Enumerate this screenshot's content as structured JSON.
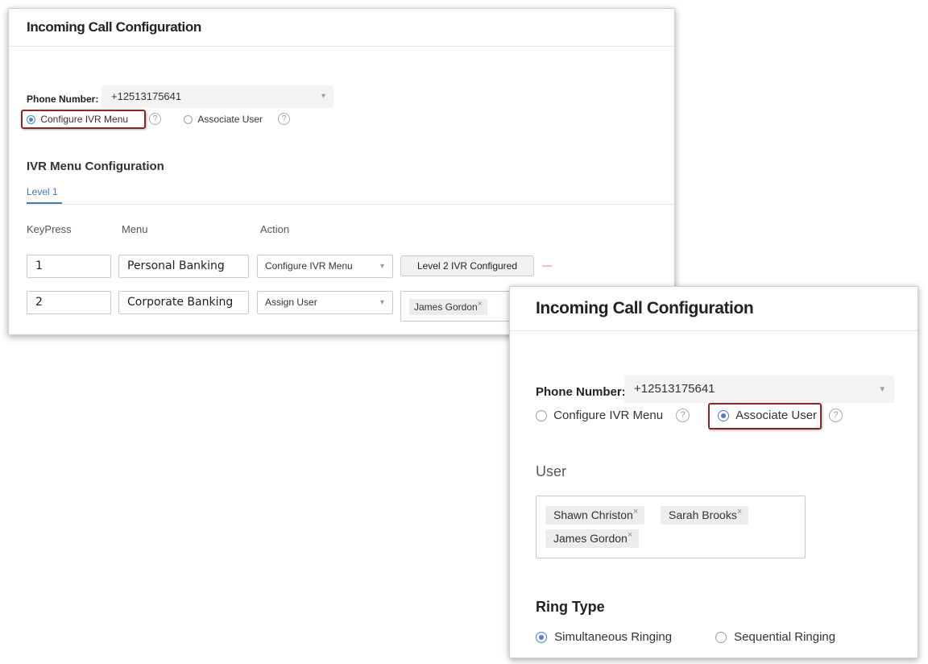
{
  "left_panel": {
    "title": "Incoming Call Configuration",
    "phone_label": "Phone Number:",
    "phone_value": "+12513175641",
    "radio_ivr": "Configure IVR Menu",
    "radio_associate": "Associate User",
    "section_title": "IVR Menu Configuration",
    "tab_level1": "Level 1",
    "col_keypress": "KeyPress",
    "col_menu": "Menu",
    "col_action": "Action",
    "rows": [
      {
        "key": "1",
        "menu": "Personal Banking",
        "action": "Configure IVR Menu",
        "button": "Level 2 IVR Configured",
        "remove": "—"
      },
      {
        "key": "2",
        "menu": "Corporate Banking",
        "action": "Assign User",
        "chip": "James Gordon"
      }
    ]
  },
  "right_panel": {
    "title": "Incoming Call Configuration",
    "phone_label": "Phone Number:",
    "phone_value": "+12513175641",
    "radio_ivr": "Configure IVR Menu",
    "radio_associate": "Associate User",
    "user_title": "User",
    "users": [
      "Shawn Christon",
      "Sarah Brooks",
      "James Gordon"
    ],
    "ring_title": "Ring Type",
    "ring_simultaneous": "Simultaneous Ringing",
    "ring_sequential": "Sequential Ringing"
  },
  "icons": {
    "help": "?",
    "remove_chip": "×",
    "caret": "▾"
  },
  "colors": {
    "accent": "#4a7fd4",
    "highlight_border": "#8b2626",
    "remove_red": "#e05a4a"
  }
}
